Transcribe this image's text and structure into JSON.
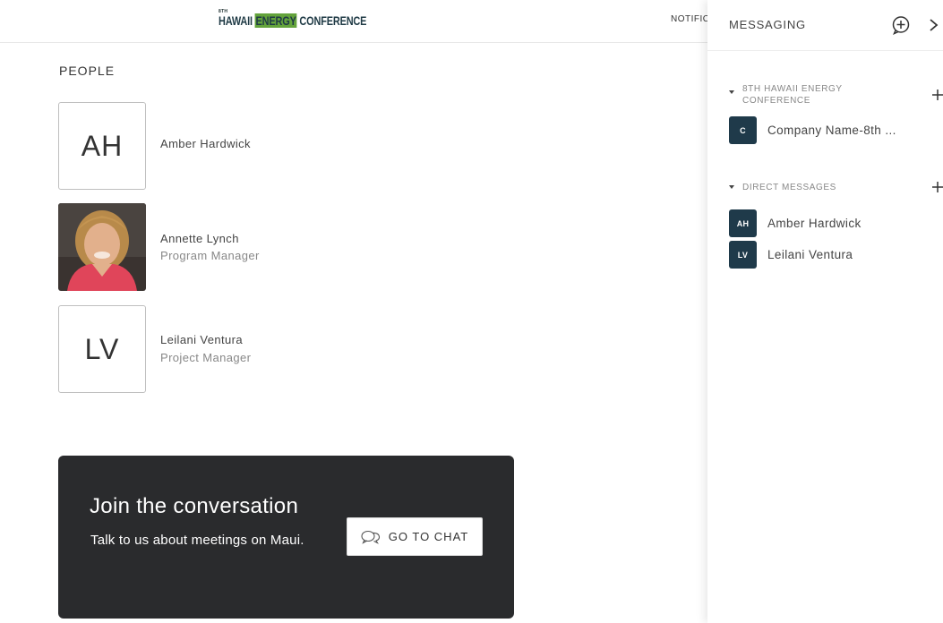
{
  "header": {
    "logo_small": "8TH",
    "logo_part1": "HAWAII ",
    "logo_part2": "ENERGY",
    "logo_part3": " CONFERENCE",
    "notifications_label": "NOTIFIC"
  },
  "people": {
    "title": "PEOPLE",
    "items": [
      {
        "initials": "AH",
        "name": "Amber Hardwick",
        "role": ""
      },
      {
        "initials": "",
        "name": "Annette Lynch",
        "role": "Program Manager",
        "photo": true
      },
      {
        "initials": "LV",
        "name": "Leilani Ventura",
        "role": "Project Manager"
      }
    ]
  },
  "join_card": {
    "title": "Join the conversation",
    "subtitle": "Talk to us about meetings on Maui.",
    "button_label": "GO TO CHAT",
    "button_icon": "chat-bubbles-icon"
  },
  "messaging": {
    "title": "MESSAGING",
    "add_icon": "add-chat-icon",
    "close_icon": "chevron-right-icon",
    "sections": [
      {
        "label": "8TH HAWAII ENERGY CONFERENCE",
        "items": [
          {
            "avatar": "C",
            "label": "Company Name-8th ..."
          }
        ]
      },
      {
        "label": "DIRECT MESSAGES",
        "items": [
          {
            "avatar": "AH",
            "label": "Amber Hardwick"
          },
          {
            "avatar": "LV",
            "label": "Leilani Ventura"
          }
        ]
      }
    ]
  },
  "colors": {
    "card_bg": "#2a2b2d",
    "avatar_bg": "#1f3a4a",
    "logo_green": "#63a33b"
  }
}
